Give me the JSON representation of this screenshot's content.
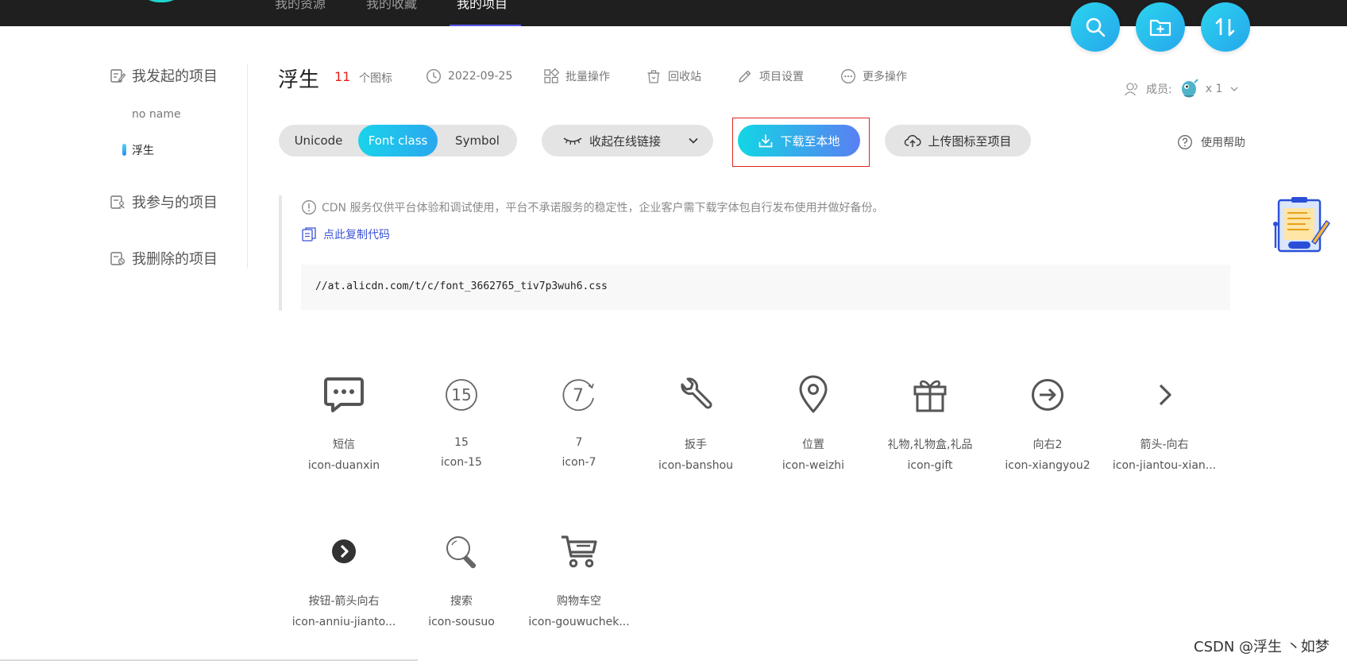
{
  "top_nav": {
    "items": [
      {
        "label": "我的资源",
        "active": false
      },
      {
        "label": "我的收藏",
        "active": false
      },
      {
        "label": "我的项目",
        "active": true
      }
    ],
    "action_icons": [
      "search-icon",
      "add-folder-icon",
      "sort-icon"
    ]
  },
  "sidebar": {
    "sections": [
      {
        "label": "我发起的项目",
        "icon": "edit-doc-icon"
      },
      {
        "label": "我参与的项目",
        "icon": "user-doc-icon"
      },
      {
        "label": "我删除的项目",
        "icon": "deleted-doc-icon"
      }
    ],
    "projects": [
      {
        "label": "no name",
        "active": false
      },
      {
        "label": "浮生",
        "active": true
      }
    ]
  },
  "header": {
    "title": "浮生",
    "icon_count": "11",
    "icon_count_label": "个图标",
    "date": "2022-09-25",
    "batch": "批量操作",
    "recycle": "回收站",
    "settings": "项目设置",
    "more": "更多操作",
    "members_label": "成员:",
    "members_count": "x 1"
  },
  "toolbar": {
    "tabs": [
      {
        "label": "Unicode",
        "active": false
      },
      {
        "label": "Font class",
        "active": true
      },
      {
        "label": "Symbol",
        "active": false
      }
    ],
    "collapse_label": "收起在线链接",
    "download_label": "下载至本地",
    "upload_label": "上传图标至项目",
    "help_label": "使用帮助"
  },
  "notice": {
    "text": "CDN 服务仅供平台体验和调试使用，平台不承诺服务的稳定性，企业客户需下载字体包自行发布使用并做好备份。",
    "copy_label": "点此复制代码",
    "code": "//at.alicdn.com/t/c/font_3662765_tiv7p3wuh6.css"
  },
  "icons": [
    {
      "name": "短信",
      "code": "icon-duanxin",
      "glyph": "sms-icon"
    },
    {
      "name": "15",
      "code": "icon-15",
      "glyph": "number-15-icon"
    },
    {
      "name": "7",
      "code": "icon-7",
      "glyph": "number-7-icon"
    },
    {
      "name": "扳手",
      "code": "icon-banshou",
      "glyph": "wrench-icon"
    },
    {
      "name": "位置",
      "code": "icon-weizhi",
      "glyph": "location-icon"
    },
    {
      "name": "礼物,礼物盒,礼品",
      "code": "icon-gift",
      "glyph": "gift-icon"
    },
    {
      "name": "向右2",
      "code": "icon-xiangyou2",
      "glyph": "circle-arrow-right-icon"
    },
    {
      "name": "箭头-向右",
      "code": "icon-jiantou-xian...",
      "glyph": "chevron-right-icon"
    },
    {
      "name": "按钮-箭头向右",
      "code": "icon-anniu-jianto...",
      "glyph": "filled-circle-chevron-icon"
    },
    {
      "name": "搜索",
      "code": "icon-sousuo",
      "glyph": "search-icon"
    },
    {
      "name": "购物车空",
      "code": "icon-gouwuchek...",
      "glyph": "cart-icon"
    }
  ],
  "watermark": "CSDN @浮生 丶如梦",
  "colors": {
    "accent_cyan": "#1ad3ea",
    "accent_blue": "#2aa7ef",
    "download_gradient_end": "#5a7ff2",
    "highlight_border": "#e0241f",
    "count_red": "#e2231a",
    "link_blue": "#3b52d6",
    "topbar": "#1f1f1f"
  }
}
